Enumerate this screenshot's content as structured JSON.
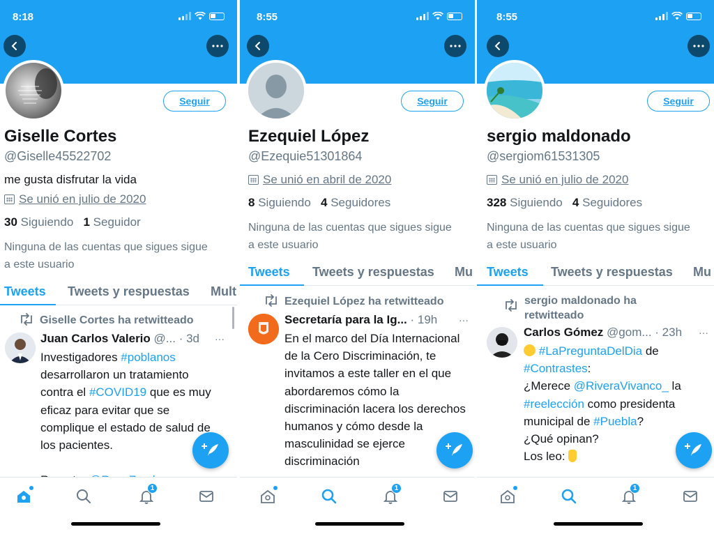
{
  "colors": {
    "accent": "#1da1f2",
    "text": "#14171a",
    "muted": "#657786"
  },
  "icons": [
    "back-icon",
    "more-icon",
    "calendar-icon",
    "retweet-icon",
    "compose-icon",
    "home-icon",
    "search-icon",
    "notifications-icon",
    "messages-icon"
  ],
  "panels": [
    {
      "time": "8:18",
      "follow_label": "Seguir",
      "name": "Giselle Cortes",
      "handle": "@Giselle45522702",
      "bio": "me gusta disfrutar la vida",
      "joined": "Se unió en julio de 2020",
      "following_count": "30",
      "following_label": "Siguiendo",
      "followers_count": "1",
      "followers_label": "Seguidor",
      "ninguna": "Ninguna de las cuentas que sigues sigue a este usuario",
      "tabs": [
        "Tweets",
        "Tweets y respuestas",
        "Mult"
      ],
      "retweeted_by": "Giselle Cortes ha retwitteado",
      "tweet": {
        "author": "Juan Carlos Valerio",
        "handle": "@...",
        "time": "· 3d",
        "text_1": "Investigadores ",
        "tag_1": "#poblanos",
        "text_2": " desarrollaron un tratamiento contra el ",
        "tag_2": "#COVID19",
        "text_3": " que es muy eficaz para evitar que se complique el estado de salud de los pacientes.",
        "text_4": "Reporta: ",
        "mention_1": "@RosaZamb..."
      },
      "notification_badge": "1"
    },
    {
      "time": "8:55",
      "follow_label": "Seguir",
      "name": "Ezequiel López",
      "handle": "@Ezequie51301864",
      "joined": "Se unió en abril de 2020",
      "following_count": "8",
      "following_label": "Siguiendo",
      "followers_count": "4",
      "followers_label": "Seguidores",
      "ninguna": "Ninguna de las cuentas que sigues sigue a este usuario",
      "tabs": [
        "Tweets",
        "Tweets y respuestas",
        "Mu"
      ],
      "retweeted_by": "Ezequiel López ha retwitteado",
      "tweet": {
        "author": "Secretaría para la Ig...",
        "time": "· 19h",
        "text_1": "En el marco del Día Internacional de la Cero Discriminación,  te invitamos a este taller en el que abordaremos cómo la discriminación lacera los derechos humanos y cómo desde la masculinidad se ejerce discriminación"
      },
      "notification_badge": "1"
    },
    {
      "time": "8:55",
      "follow_label": "Seguir",
      "name": "sergio maldonado",
      "handle": "@sergiom61531305",
      "joined": "Se unió en julio de 2020",
      "following_count": "328",
      "following_label": "Siguiendo",
      "followers_count": "4",
      "followers_label": "Seguidores",
      "ninguna": "Ninguna de las cuentas que sigues sigue a este usuario",
      "tabs": [
        "Tweets",
        "Tweets y respuestas",
        "Mu"
      ],
      "retweeted_by": "sergio maldonado ha retwitteado",
      "tweet": {
        "author": "Carlos Gómez",
        "handle": "@gom...",
        "time": "· 23h",
        "tag_1": "#LaPreguntaDelDia",
        "text_1": " de ",
        "tag_2": "#Contrastes",
        "text_2": ":",
        "text_3": "¿Merece ",
        "mention_1": "@RiveraVivanco_",
        "text_4": " la ",
        "tag_3": "#reelección",
        "text_5": " como presidenta municipal de ",
        "tag_4": "#Puebla",
        "text_6": "?",
        "text_7": "¿Qué opinan?",
        "text_8": "Los leo: "
      },
      "notification_badge": "1"
    }
  ]
}
